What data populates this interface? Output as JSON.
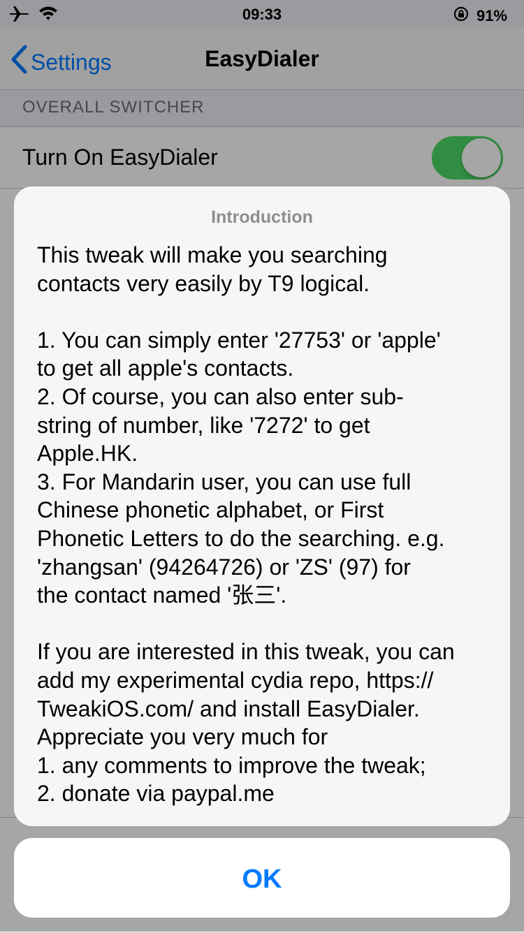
{
  "status_bar": {
    "time": "09:33",
    "battery": "91%",
    "icons": [
      "airplane-icon",
      "wifi-icon",
      "orientation-lock-icon"
    ]
  },
  "nav": {
    "back_label": "Settings",
    "title": "EasyDialer"
  },
  "section": {
    "header": "OVERALL SWITCHER"
  },
  "row": {
    "label": "Turn On EasyDialer",
    "toggle_on": true
  },
  "sheet": {
    "title": "Introduction",
    "message": "This tweak will make you searching\ncontacts very easily by T9 logical.\n\n1. You can simply enter '27753' or 'apple'\nto get all apple's contacts.\n2. Of course, you can also enter sub-\nstring of number, like '7272' to get\nApple.HK.\n3. For Mandarin user, you can use full\nChinese phonetic alphabet, or First\nPhonetic Letters to do the searching. e.g.\n'zhangsan' (94264726) or 'ZS' (97) for\nthe contact named '张三'.\n\nIf you are interested in this tweak, you can\nadd my experimental cydia repo, https://\nTweakiOS.com/ and install EasyDialer.\nAppreciate you very much for\n1. any comments to improve the tweak;\n2. donate via paypal.me",
    "ok_label": "OK"
  },
  "colors": {
    "accent": "#007aff",
    "toggle_on": "#4cd964",
    "sheet_title": "#8e8e93"
  }
}
